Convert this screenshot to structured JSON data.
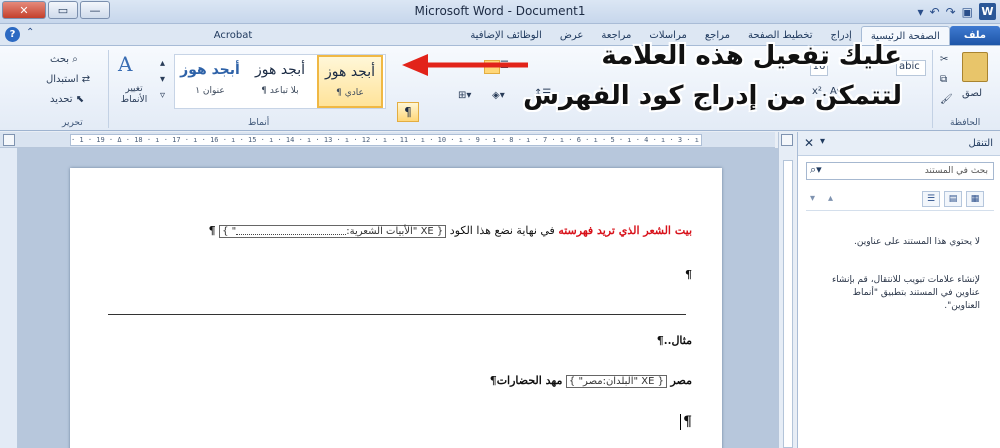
{
  "window": {
    "title": "Microsoft Word - Document1",
    "minimize": "—",
    "maximize": "▭",
    "close": "✕",
    "app_icon": "W"
  },
  "tabs": [
    {
      "label": "ملف"
    },
    {
      "label": "الصفحة الرئيسية"
    },
    {
      "label": "إدراج"
    },
    {
      "label": "تخطيط الصفحة"
    },
    {
      "label": "مراجع"
    },
    {
      "label": "مراسلات"
    },
    {
      "label": "مراجعة"
    },
    {
      "label": "عرض"
    },
    {
      "label": "الوظائف الإضافية"
    },
    {
      "label": "Acrobat"
    }
  ],
  "ribbon": {
    "group_clipboard": "الحافظة",
    "paste_label": "لصق",
    "group_styles": "أنماط",
    "group_editing": "تحرير",
    "find_label": "بحث",
    "replace_label": "استبدال",
    "select_label": "تحديد",
    "change_styles_label": "تغيير الأنماط",
    "font_sample": "abic",
    "font_size": "16",
    "pilcrow": "¶",
    "styles": [
      {
        "title": "أبجد هوز",
        "sub": "¶ عادي"
      },
      {
        "title": "أبجد هوز",
        "sub": "¶ بلا تباعد"
      },
      {
        "title": "أبجد هوز",
        "sub": "عنوان ١"
      }
    ]
  },
  "annotation": {
    "line1": "عليك تفعيل هذه العلامة",
    "line2": "لتتمكن من إدراج كود الفهرس"
  },
  "ruler_text": "· 1 · 19 · Δ · 18 · ı · 17 · ı · 16 · ı · 15 · ı · 14 · ı · 13 · ı · 12 · ı · 11 · ı · 10 · ı · 9 · ı · 8 · ı · 7 · ı · 6 · ı · 5 · ı · 4 · ı · 3 · ı · 2 · ı · 1 · ı · Δ · ı · 1",
  "document": {
    "line1_red": "بيت الشعر الذي تريد فهرسته",
    "line1_rest": "في نهاية نضع هذا الكود",
    "line1_field_open": "{ XE \"الأبيات الشعرية:",
    "line1_field_close": "\" }",
    "pilcrow": "¶",
    "example_label": "مثال..",
    "line3_start": "مصر",
    "line3_field": "{ XE \"البلدان:مصر\" }",
    "line3_end": "مهد الحضارات"
  },
  "nav": {
    "title": "التنقل",
    "search_placeholder": "بحث في المستند",
    "msg1": "لا يحتوي هذا المستند على عناوين.",
    "msg2": "لإنشاء علامات تبويب للانتقال، قم بإنشاء عناوين في المستند بتطبيق \"أنماط العناوين\"."
  }
}
